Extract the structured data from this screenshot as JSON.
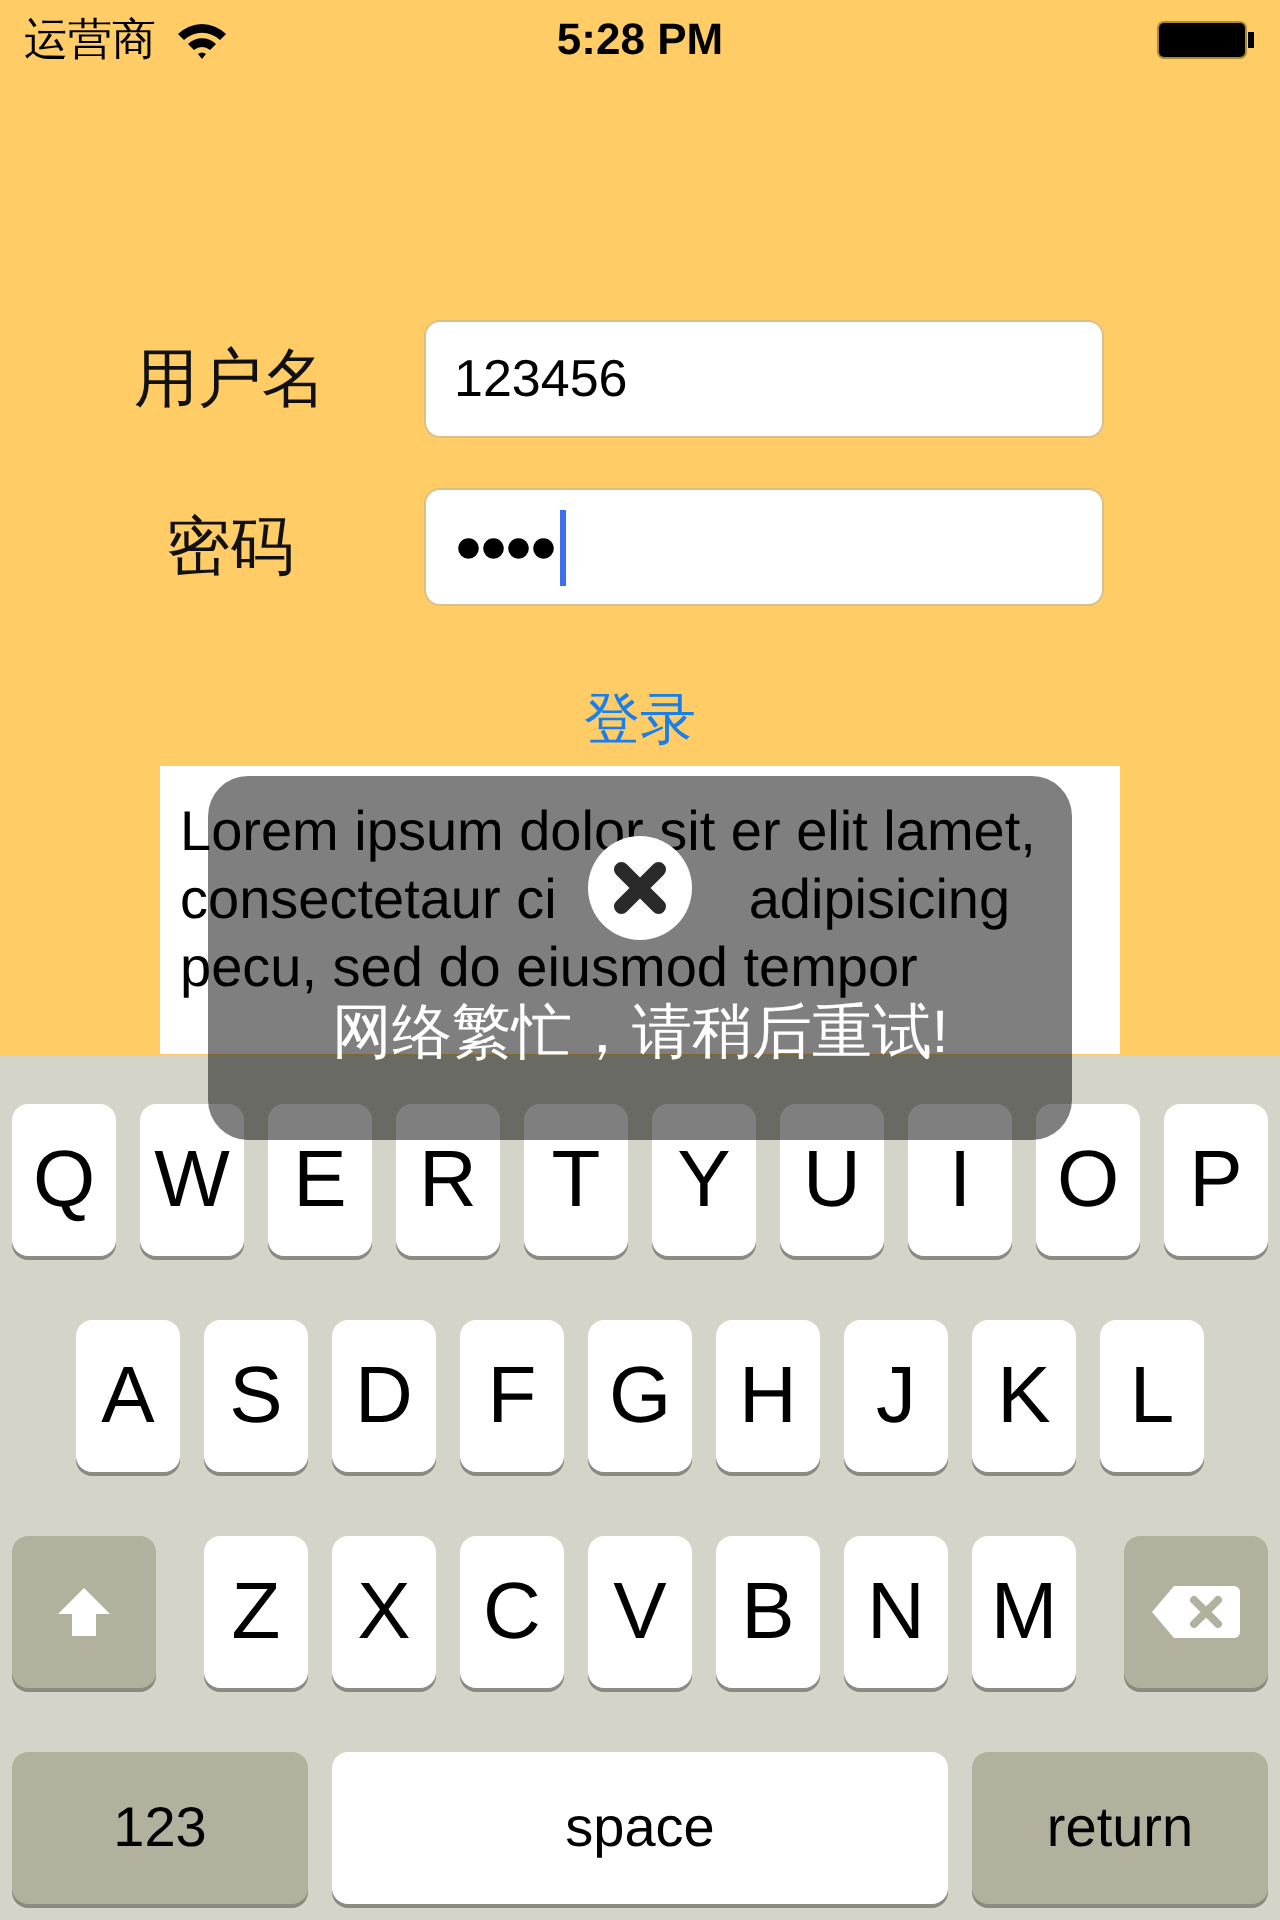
{
  "status_bar": {
    "carrier": "运营商",
    "time": "5:28 PM"
  },
  "form": {
    "fields": [
      {
        "kind": "text",
        "label": "用户名",
        "value": "123456",
        "focused": false
      },
      {
        "kind": "password",
        "label": "密码",
        "value": "●●●●",
        "focused": true
      }
    ],
    "login_link": "登录"
  },
  "text_view": {
    "lines": [
      [
        "Lorem ipsum dolor sit er elit lamet,"
      ],
      [
        "consectetaur ci",
        "adipisicing"
      ],
      [
        "pecu, sed do eiusmod tempor"
      ]
    ]
  },
  "toast": {
    "message": "网络繁忙，请稍后重试!"
  },
  "keyboard": {
    "rows": [
      [
        {
          "kind": "letter",
          "label": "Q"
        },
        {
          "kind": "letter",
          "label": "W"
        },
        {
          "kind": "letter",
          "label": "E"
        },
        {
          "kind": "letter",
          "label": "R"
        },
        {
          "kind": "letter",
          "label": "T"
        },
        {
          "kind": "letter",
          "label": "Y"
        },
        {
          "kind": "letter",
          "label": "U"
        },
        {
          "kind": "letter",
          "label": "I"
        },
        {
          "kind": "letter",
          "label": "O"
        },
        {
          "kind": "letter",
          "label": "P"
        }
      ],
      [
        {
          "kind": "letter",
          "label": "A"
        },
        {
          "kind": "letter",
          "label": "S"
        },
        {
          "kind": "letter",
          "label": "D"
        },
        {
          "kind": "letter",
          "label": "F"
        },
        {
          "kind": "letter",
          "label": "G"
        },
        {
          "kind": "letter",
          "label": "H"
        },
        {
          "kind": "letter",
          "label": "J"
        },
        {
          "kind": "letter",
          "label": "K"
        },
        {
          "kind": "letter",
          "label": "L"
        }
      ],
      [
        {
          "kind": "shift"
        },
        {
          "kind": "letter",
          "label": "Z"
        },
        {
          "kind": "letter",
          "label": "X"
        },
        {
          "kind": "letter",
          "label": "C"
        },
        {
          "kind": "letter",
          "label": "V"
        },
        {
          "kind": "letter",
          "label": "B"
        },
        {
          "kind": "letter",
          "label": "N"
        },
        {
          "kind": "letter",
          "label": "M"
        },
        {
          "kind": "delete"
        }
      ]
    ],
    "bottom_row": [
      {
        "kind": "mode",
        "label": "123"
      },
      {
        "kind": "space",
        "label": "space"
      },
      {
        "kind": "return",
        "label": "return"
      }
    ]
  }
}
